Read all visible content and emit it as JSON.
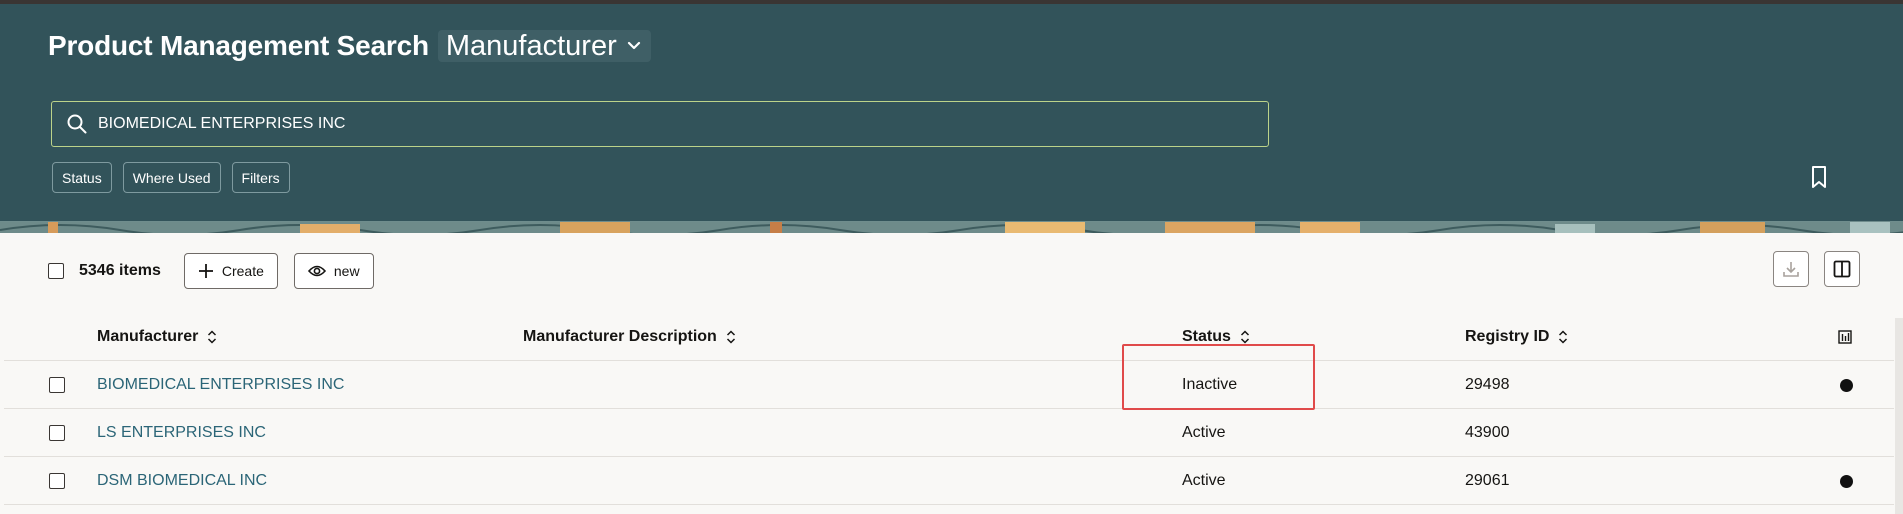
{
  "header": {
    "title": "Product Management Search",
    "context_selector": "Manufacturer",
    "search_value": "BIOMEDICAL ENTERPRISES INC",
    "chips": [
      "Status",
      "Where Used",
      "Filters"
    ]
  },
  "toolbar": {
    "items_count": "5346 items",
    "create_label": "Create",
    "view_label": "new"
  },
  "table": {
    "columns": [
      "Manufacturer",
      "Manufacturer Description",
      "Status",
      "Registry ID"
    ],
    "rows": [
      {
        "manufacturer": "BIOMEDICAL ENTERPRISES INC",
        "description": "",
        "status": "Inactive",
        "registry_id": "29498",
        "indicator": true
      },
      {
        "manufacturer": "LS ENTERPRISES INC",
        "description": "",
        "status": "Active",
        "registry_id": "43900",
        "indicator": false
      },
      {
        "manufacturer": "DSM BIOMEDICAL INC",
        "description": "",
        "status": "Active",
        "registry_id": "29061",
        "indicator": true
      }
    ]
  },
  "colors": {
    "header_bg": "#32535a",
    "link": "#2b6577",
    "highlight_border": "#e04a4a"
  },
  "icons": [
    "chevron-down-icon",
    "search-icon",
    "bookmark-icon",
    "plus-icon",
    "eye-icon",
    "download-icon",
    "columns-icon",
    "sort-icon",
    "column-settings-icon",
    "status-dot-icon"
  ]
}
